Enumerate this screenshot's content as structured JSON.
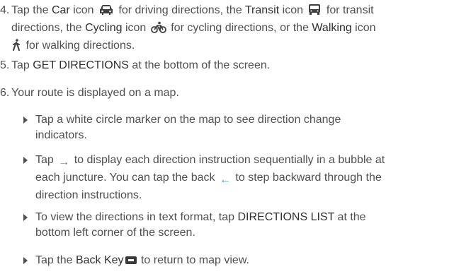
{
  "step4": {
    "num": "4.",
    "t1": "Tap the ",
    "car": "Car",
    "t2": " icon ",
    "t3": " for driving directions, the ",
    "transit": "Transit",
    "t4": " icon ",
    "t5": " for transit",
    "t6": "directions, the ",
    "cycling": "Cycling",
    "t7": " icon ",
    "t8": " for cycling directions, or the ",
    "walking": "Walking",
    "t9": " icon",
    "t10": " for walking directions."
  },
  "step5": {
    "num": "5.",
    "t1": "Tap ",
    "bold": "GET DIRECTIONS",
    "t2": " at the bottom of the screen."
  },
  "step6": {
    "num": "6.",
    "text": "Your route is displayed on a map."
  },
  "bullet1": {
    "l1": "Tap a white circle marker on the map to see direction change",
    "l2": "indicators."
  },
  "bullet2": {
    "a": "Tap ",
    "b": " to display each direction instruction sequentially in a bubble at",
    "l2a": "each juncture. You can tap the back ",
    "l2b": " to step backward through the",
    "l3": "direction instructions."
  },
  "bullet3": {
    "a": "To view the directions in text format, tap ",
    "bold": "DIRECTIONS LIST",
    "b": " at the",
    "l2": "bottom left corner of the screen."
  },
  "bullet4": {
    "a": "Tap the ",
    "bold": "Back Key",
    "b": " to return to map view."
  },
  "icons": {
    "car": "car-icon",
    "transit": "bus-icon",
    "cycling": "bicycle-icon",
    "walking": "walking-icon",
    "forward": "right-arrow-icon",
    "back": "left-arrow-icon",
    "back_key": "back-key-icon",
    "accent": "#4c8ccc"
  }
}
